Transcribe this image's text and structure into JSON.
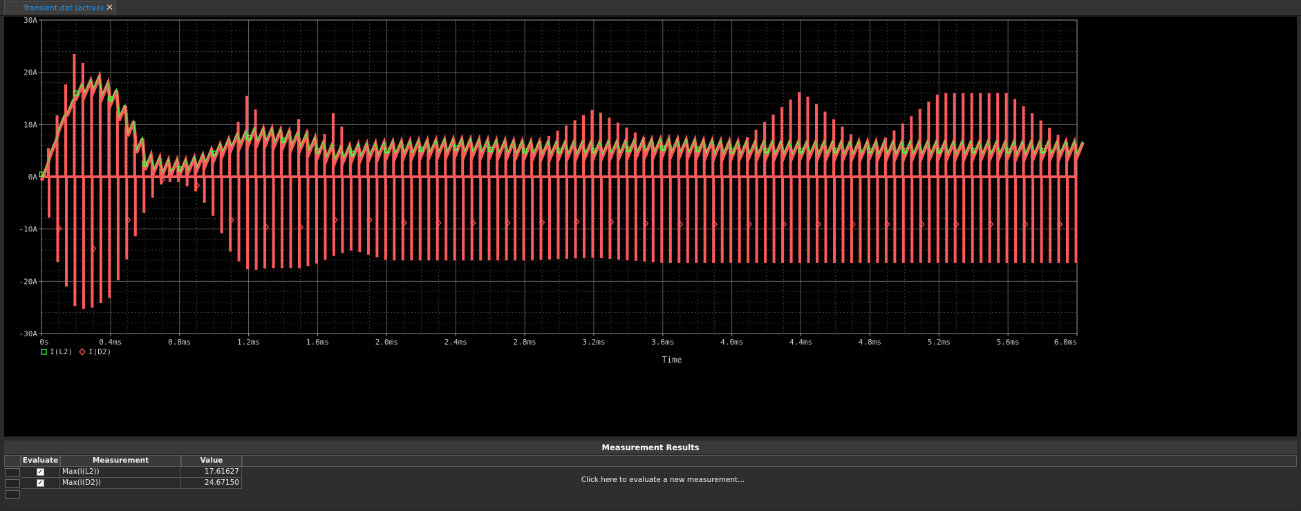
{
  "tab": {
    "label": "Transient.dat (active)",
    "close_glyph": "✕"
  },
  "plot": {
    "background": "#000000",
    "grid_color": "#9a9a9a",
    "trace_colors": {
      "I(L2)": "#44ff44",
      "I(D2)": "#ff5a5a"
    },
    "y_tick_labels": [
      "30A",
      "20A",
      "10A",
      "0A",
      "-10A",
      "-20A",
      "-30A"
    ],
    "x_tick_labels": [
      "0s",
      "0.4ms",
      "0.8ms",
      "1.2ms",
      "1.6ms",
      "2.0ms",
      "2.4ms",
      "2.8ms",
      "3.2ms",
      "3.6ms",
      "4.0ms",
      "4.4ms",
      "4.8ms",
      "5.2ms",
      "5.6ms",
      "6.0ms"
    ],
    "x_axis_label": "Time",
    "legend": [
      {
        "marker": "square",
        "label": "I(L2)"
      },
      {
        "marker": "diamond",
        "label": "I(D2)"
      }
    ]
  },
  "chart_data": {
    "type": "line",
    "x_unit": "ms",
    "y_unit": "A",
    "xlim": [
      0,
      6.0
    ],
    "ylim": [
      -30,
      30
    ],
    "grid": true,
    "legend_placement": "bottom-left",
    "xlabel": "Time",
    "series": [
      {
        "name": "I(L2)",
        "color": "#44ff44",
        "x": [
          0,
          0.1,
          0.2,
          0.3,
          0.4,
          0.5,
          0.6,
          0.7,
          0.8,
          0.9,
          1.0,
          1.1,
          1.2,
          1.3,
          1.4,
          1.5,
          1.6,
          1.7,
          1.8,
          2.0,
          2.4,
          2.8,
          3.2,
          3.6,
          4.0,
          4.4,
          4.8,
          5.2,
          5.6,
          6.0
        ],
        "values": [
          0.5,
          10,
          16,
          17.5,
          15,
          9,
          2.5,
          1.5,
          1.5,
          2.5,
          4.5,
          6.5,
          7.5,
          7.5,
          7,
          6.5,
          5,
          4,
          4.5,
          5,
          5.5,
          5,
          5,
          5.5,
          5,
          5,
          5,
          5,
          5,
          5
        ]
      },
      {
        "name": "I(D2)",
        "color": "#ff5a5a",
        "x": [
          0,
          0.1,
          0.2,
          0.3,
          0.4,
          0.5,
          0.6,
          0.7,
          0.8,
          0.9,
          1.0,
          1.1,
          1.2,
          1.3,
          1.4,
          1.5,
          1.6,
          1.7,
          1.8,
          2.0,
          2.4,
          2.8,
          3.2,
          3.6,
          4.0,
          4.4,
          4.8,
          5.2,
          5.6,
          6.0
        ],
        "values_peak": [
          0.5,
          13,
          24.7,
          17.5,
          15,
          9,
          2.5,
          1.5,
          1.5,
          2.5,
          4.5,
          6.5,
          16.5,
          7.5,
          7,
          11.5,
          5,
          13,
          4.5,
          5,
          5.5,
          5,
          13,
          5.5,
          5,
          16.5,
          5,
          16,
          16,
          5
        ],
        "values_min": [
          -1,
          -18,
          -25.5,
          -25,
          -23,
          -15,
          -6,
          -1,
          -1,
          -3,
          -8,
          -15,
          -18,
          -17.5,
          -17.5,
          -17.5,
          -16.5,
          -15,
          -14,
          -16,
          -16,
          -16,
          -15.5,
          -16.5,
          -16.5,
          -16.5,
          -16.5,
          -16.5,
          -16.5,
          -16.5
        ]
      }
    ]
  },
  "results": {
    "title": "Measurement Results",
    "columns": {
      "evaluate": "Evaluate",
      "measurement": "Measurement",
      "value": "Value"
    },
    "rows": [
      {
        "checked": true,
        "measurement": "Max(I(L2))",
        "value": "17.61627"
      },
      {
        "checked": true,
        "measurement": "Max(I(D2))",
        "value": "24.67150"
      }
    ],
    "new_measurement": "Click here to evaluate a new measurement..."
  }
}
